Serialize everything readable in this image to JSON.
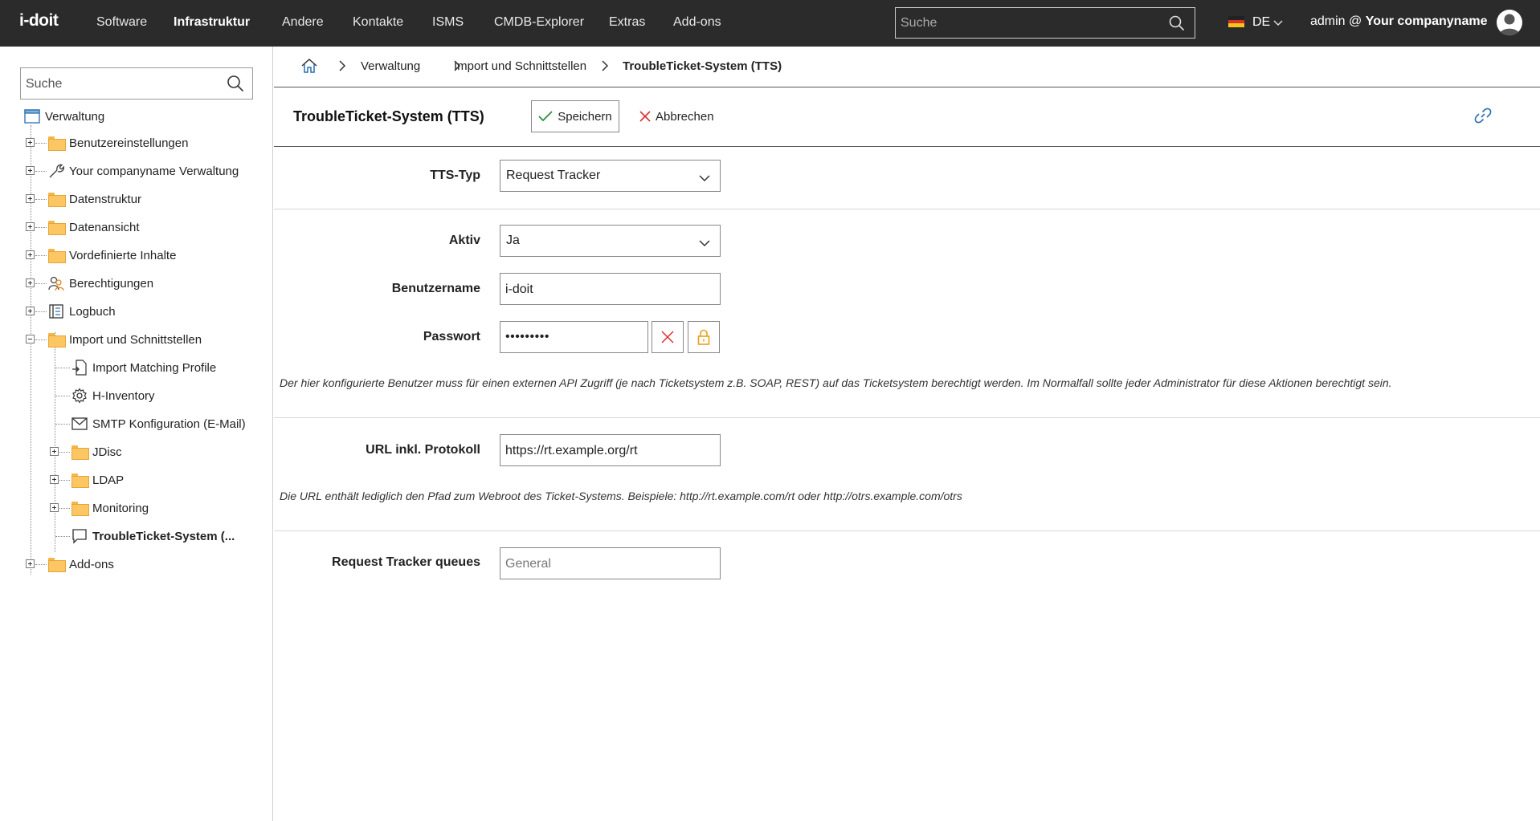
{
  "app": {
    "logo": "i-doit",
    "nav": [
      "Software",
      "Infrastruktur",
      "Andere",
      "Kontakte",
      "ISMS",
      "CMDB-Explorer",
      "Extras",
      "Add-ons"
    ],
    "active_nav": "Infrastruktur",
    "search_placeholder": "Suche",
    "language": "DE",
    "user_prefix": "admin @",
    "user_company": "Your companyname"
  },
  "sidebar": {
    "search_placeholder": "Suche",
    "root": "Verwaltung",
    "items": [
      {
        "label": "Benutzereinstellungen",
        "icon": "folder-icon"
      },
      {
        "label": "Your companyname Verwaltung",
        "icon": "wrench-icon"
      },
      {
        "label": "Datenstruktur",
        "icon": "folder-icon"
      },
      {
        "label": "Datenansicht",
        "icon": "folder-icon"
      },
      {
        "label": "Vordefinierte Inhalte",
        "icon": "folder-icon"
      },
      {
        "label": "Berechtigungen",
        "icon": "users-icon"
      },
      {
        "label": "Logbuch",
        "icon": "logbook-icon"
      },
      {
        "label": "Import und Schnittstellen",
        "icon": "folder-icon"
      },
      {
        "label": "Import Matching Profile",
        "icon": "document-import-icon"
      },
      {
        "label": "H-Inventory",
        "icon": "gear-icon"
      },
      {
        "label": "SMTP Konfiguration (E-Mail)",
        "icon": "mail-icon"
      },
      {
        "label": "JDisc",
        "icon": "folder-icon"
      },
      {
        "label": "LDAP",
        "icon": "folder-icon"
      },
      {
        "label": "Monitoring",
        "icon": "folder-icon"
      },
      {
        "label": "TroubleTicket-System (...",
        "icon": "chat-icon"
      },
      {
        "label": "Add-ons",
        "icon": "folder-icon"
      }
    ]
  },
  "breadcrumb": [
    "Verwaltung",
    "Import und Schnittstellen",
    "TroubleTicket-System (TTS)"
  ],
  "page": {
    "title": "TroubleTicket-System (TTS)",
    "save_label": "Speichern",
    "cancel_label": "Abbrechen"
  },
  "form": {
    "tts_type_label": "TTS-Typ",
    "tts_type_value": "Request Tracker",
    "active_label": "Aktiv",
    "active_value": "Ja",
    "username_label": "Benutzername",
    "username_value": "i-doit",
    "password_label": "Passwort",
    "password_value": "•••••••••",
    "user_hint": "Der hier konfigurierte Benutzer muss für einen externen API Zugriff (je nach Ticketsystem z.B. SOAP, REST) auf das Ticketsystem berechtigt werden. Im Normalfall sollte jeder Administrator für diese Aktionen berechtigt sein.",
    "url_label": "URL inkl. Protokoll",
    "url_value": "https://rt.example.org/rt",
    "url_hint": "Die URL enthält lediglich den Pfad zum Webroot des Ticket-Systems. Beispiele: http://rt.example.com/rt oder http://otrs.example.com/otrs",
    "queues_label": "Request Tracker queues",
    "queues_placeholder": "General"
  },
  "colors": {
    "topbar": "#2b2b2b",
    "folder": "#fcc662",
    "link_icon": "#2a6fb0",
    "cancel_x": "#d9302c",
    "lock": "#e8a21c"
  }
}
